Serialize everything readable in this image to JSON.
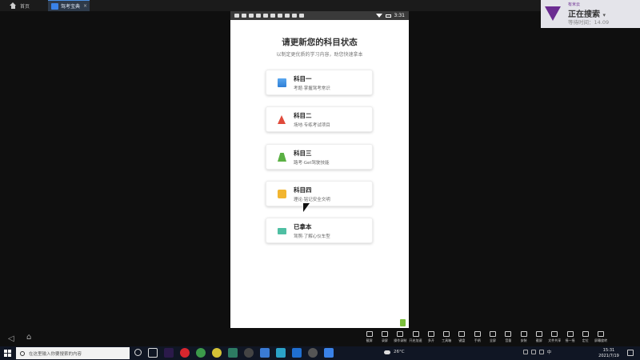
{
  "emulator": {
    "home_tab_label": "首页",
    "app_tab_label": "驾考宝典",
    "tab_close": "×",
    "nav_back": "◁",
    "nav_home": "⌂"
  },
  "phone": {
    "status_time": "3:31",
    "title": "请更新您的科目状态",
    "subtitle": "以制定更优质的学习内容，助您快速拿本",
    "cards": [
      {
        "title": "科目一",
        "subtitle": "考题·掌握驾考常识",
        "icon": "book-icon"
      },
      {
        "title": "科目二",
        "subtitle": "场地·专练考试项目",
        "icon": "traffic-cone-icon"
      },
      {
        "title": "科目三",
        "subtitle": "路考·Get驾驶技能",
        "icon": "road-icon"
      },
      {
        "title": "科目四",
        "subtitle": "理论·铭记安全文明",
        "icon": "traffic-light-icon"
      },
      {
        "title": "已拿本",
        "subtitle": "驾照·了解心仪车型",
        "icon": "license-card-icon"
      }
    ]
  },
  "notice": {
    "small_label": "有米云",
    "title": "正在搜索",
    "chevron": "▾",
    "wait_time": "等待时间：14.09"
  },
  "tools": [
    {
      "label": "截屏"
    },
    {
      "label": "录屏"
    },
    {
      "label": "操作录制"
    },
    {
      "label": "开启加速"
    },
    {
      "label": "多开"
    },
    {
      "label": "工具箱"
    },
    {
      "label": "键盘"
    },
    {
      "label": "手柄"
    },
    {
      "label": "全屏"
    },
    {
      "label": "音量"
    },
    {
      "label": "安装"
    },
    {
      "label": "截屏"
    },
    {
      "label": "文件共享"
    },
    {
      "label": "摇一摇"
    },
    {
      "label": "定位"
    },
    {
      "label": "屏幕旋转"
    }
  ],
  "taskbar": {
    "search_placeholder": "在这里输入你要搜索的内容",
    "weather": "26°C",
    "ime": "中",
    "time": "15:31",
    "date": "2021/7/19"
  }
}
